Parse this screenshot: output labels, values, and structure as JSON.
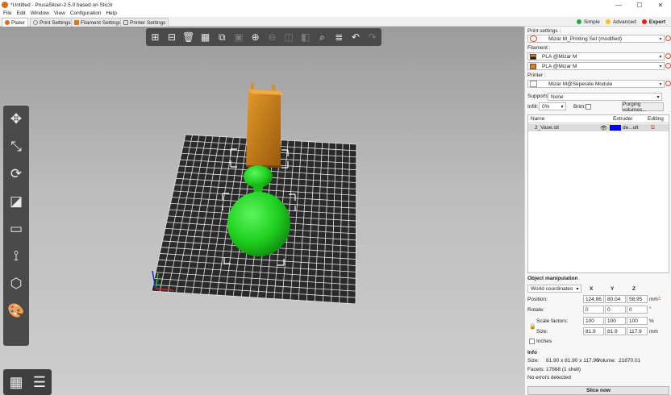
{
  "window": {
    "title": "*Untitled - PrusaSlicer-2.5.0 based on Slic3r",
    "minimize": "—",
    "maximize": "☐",
    "close": "✕"
  },
  "menu": [
    "File",
    "Edit",
    "Window",
    "View",
    "Configuration",
    "Help"
  ],
  "tabs": [
    {
      "label": "Plater",
      "icon_color": "#e06a1b"
    },
    {
      "label": "Print Settings",
      "icon_color": "#9a9a9a"
    },
    {
      "label": "Filament Settings",
      "icon_color": "#d9771e"
    },
    {
      "label": "Printer Settings",
      "icon_color": "#7a7a7a"
    }
  ],
  "modes": [
    {
      "label": "Simple",
      "color": "#1fae3a"
    },
    {
      "label": "Advanced",
      "color": "#f0c419"
    },
    {
      "label": "Expert",
      "color": "#e12020"
    }
  ],
  "viewport": {
    "top_toolbar_icons": [
      "add-icon",
      "delete-icon",
      "delete-all-icon",
      "arrange-icon",
      "copy-icon",
      "paste-icon",
      "add-instance-icon",
      "remove-instance-icon",
      "split-objects-icon",
      "split-parts-icon",
      "search-icon",
      "layers-editing-icon",
      "undo-icon",
      "redo-icon"
    ],
    "left_toolbar_icons": [
      "move-icon",
      "scale-icon",
      "rotate-icon",
      "place-on-face-icon",
      "cut-icon",
      "supports-paint-icon",
      "seam-paint-icon",
      "mmu-paint-icon"
    ],
    "object_colors": {
      "vase": "#1fd11f",
      "block": "#c87a14"
    }
  },
  "right_panel": {
    "print_settings_label": "Print settings :",
    "print_settings_value": "Mizar M_Printing Set (modified)",
    "filament_label": "Filament :",
    "filaments": [
      "PLA @Mizar M",
      "PLA @Mizar M"
    ],
    "printer_label": "Printer :",
    "printer_value": "Mizar M@Seperate Module",
    "supports_label": "Supports:",
    "supports_value": "None",
    "infill_label": "Infill:",
    "infill_value": "0%",
    "brim_label": "Brim:",
    "purging_button": "Purging volumes...",
    "object_list": {
      "columns": [
        "Name",
        "Extruder",
        "Editing"
      ],
      "rows": [
        {
          "name": "2_Vase.stl",
          "extruder": "de...ult",
          "extruder_color": "#0000ff"
        }
      ]
    },
    "object_manipulation": {
      "title": "Object manipulation",
      "coordinates": "World coordinates",
      "axes": [
        "X",
        "Y",
        "Z"
      ],
      "position_label": "Position:",
      "position": [
        "124.86",
        "80.04",
        "58.95"
      ],
      "position_unit": "mm",
      "rotate_label": "Rotate:",
      "rotate": [
        "0",
        "0",
        "0"
      ],
      "rotate_unit": "°",
      "scale_label": "Scale factors:",
      "scale": [
        "100",
        "100",
        "100"
      ],
      "scale_unit": "%",
      "size_label": "Size:",
      "size": [
        "81.9",
        "81.9",
        "117.9"
      ],
      "size_unit": "mm",
      "inches_label": "Inches"
    },
    "info": {
      "title": "Info",
      "size_label": "Size:",
      "size_value": "81.90 x 81.90 x 117.90",
      "volume_label": "Volume:",
      "volume_value": "21870.01",
      "facets_label": "Facets:",
      "facets_value": "17888 (1 shell)",
      "errors": "No errors detected"
    },
    "slice_button": "Slice now"
  }
}
